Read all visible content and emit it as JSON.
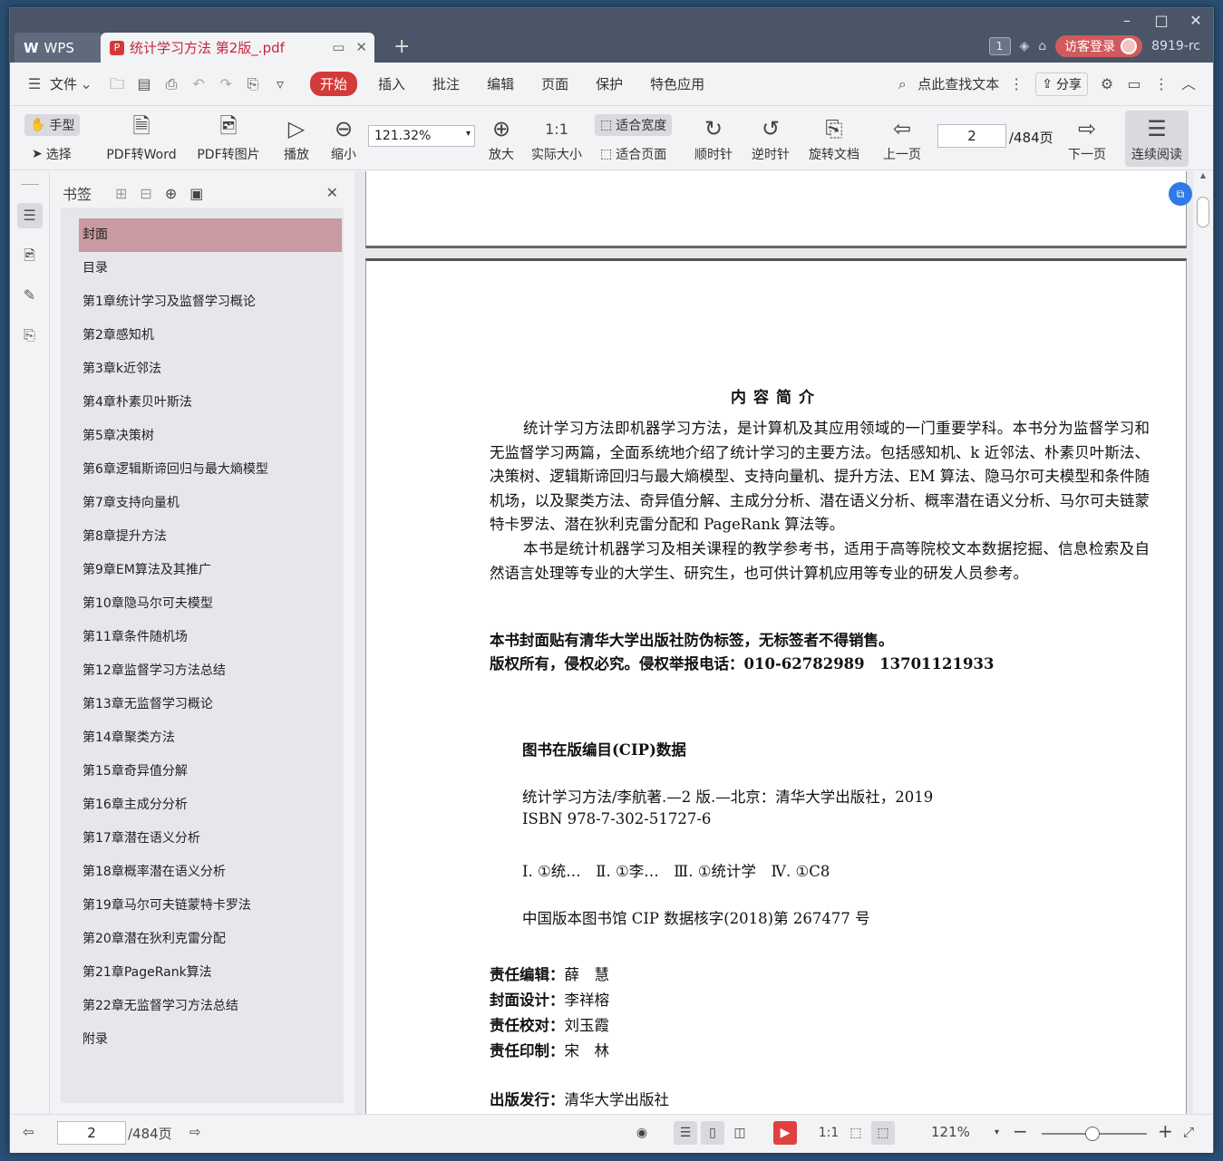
{
  "window": {
    "min": "–",
    "max": "□",
    "close": "✕"
  },
  "tabs": {
    "app_label": "WPS",
    "doc_label": "统计学习方法 第2版_.pdf",
    "add": "+"
  },
  "topright": {
    "page_badge": "1",
    "login": "访客登录",
    "user": "8919-rc"
  },
  "menu": {
    "items": [
      "文件",
      "开始",
      "插入",
      "批注",
      "编辑",
      "页面",
      "保护",
      "特色应用"
    ],
    "search": "点此查找文本",
    "share": "分享"
  },
  "toolbar": {
    "hand": "手型",
    "select": "选择",
    "pdf2word": "PDF转Word",
    "pdf2img": "PDF转图片",
    "play": "播放",
    "zoom_out": "缩小",
    "zoom_value": "121.32%",
    "zoom_in": "放大",
    "actual": "实际大小",
    "fit_width": "适合宽度",
    "fit_page": "适合页面",
    "cw": "顺时针",
    "ccw": "逆时针",
    "rotate": "旋转文档",
    "prev": "上一页",
    "page": "2",
    "total": "/484页",
    "next": "下一页",
    "continuous": "连续阅读"
  },
  "bookmarks": {
    "title": "书签",
    "items": [
      "封面",
      "目录",
      "第1章统计学习及监督学习概论",
      "第2章感知机",
      "第3章k近邻法",
      "第4章朴素贝叶斯法",
      "第5章决策树",
      "第6章逻辑斯谛回归与最大熵模型",
      "第7章支持向量机",
      "第8章提升方法",
      "第9章EM算法及其推广",
      "第10章隐马尔可夫模型",
      "第11章条件随机场",
      "第12章监督学习方法总结",
      "第13章无监督学习概论",
      "第14章聚类方法",
      "第15章奇异值分解",
      "第16章主成分分析",
      "第17章潜在语义分析",
      "第18章概率潜在语义分析",
      "第19章马尔可夫链蒙特卡罗法",
      "第20章潜在狄利克雷分配",
      "第21章PageRank算法",
      "第22章无监督学习方法总结",
      "附录"
    ]
  },
  "doc": {
    "title": "内容简介",
    "para1": "统计学习方法即机器学习方法，是计算机及其应用领域的一门重要学科。本书分为监督学习和无监督学习两篇，全面系统地介绍了统计学习的主要方法。包括感知机、k 近邻法、朴素贝叶斯法、决策树、逻辑斯谛回归与最大熵模型、支持向量机、提升方法、EM 算法、隐马尔可夫模型和条件随机场，以及聚类方法、奇异值分解、主成分分析、潜在语义分析、概率潜在语义分析、马尔可夫链蒙特卡罗法、潜在狄利克雷分配和 PageRank 算法等。",
    "para2": "本书是统计机器学习及相关课程的教学参考书，适用于高等院校文本数据挖掘、信息检索及自然语言处理等专业的大学生、研究生，也可供计算机应用等专业的研发人员参考。",
    "notice1": "本书封面贴有清华大学出版社防伪标签，无标签者不得销售。",
    "notice2": "版权所有，侵权必究。侵权举报电话：010-62782989　13701121933",
    "cip_title": "图书在版编目(CIP)数据",
    "cip1": "统计学习方法/李航著.—2 版.—北京：清华大学出版社，2019",
    "cip2": "ISBN 978-7-302-51727-6",
    "cip3": "Ⅰ. ①统…　Ⅱ. ①李…　Ⅲ. ①统计学　Ⅳ. ①C8",
    "cip4": "中国版本图书馆 CIP 数据核字(2018)第 267477 号",
    "credits": [
      {
        "k": "责任编辑：",
        "v": "薛　慧"
      },
      {
        "k": "封面设计：",
        "v": "李祥榕"
      },
      {
        "k": "责任校对：",
        "v": "刘玉霞"
      },
      {
        "k": "责任印制：",
        "v": "宋　林"
      }
    ],
    "publisher_k": "出版发行：",
    "publisher_v": "清华大学出版社"
  },
  "status": {
    "page": "2",
    "total": "/484页",
    "zoom": "121%"
  }
}
